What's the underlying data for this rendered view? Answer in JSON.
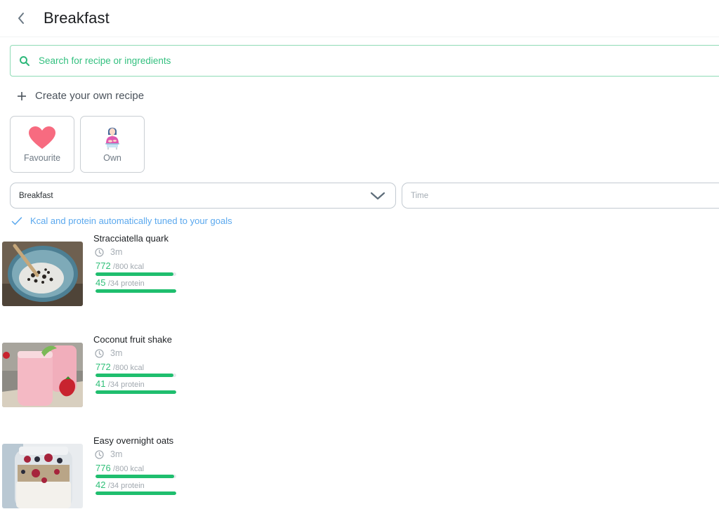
{
  "header": {
    "title": "Breakfast",
    "back_icon": "chevron-left-icon"
  },
  "search": {
    "placeholder": "Search for recipe or ingredients",
    "value": "",
    "icon": "search-icon"
  },
  "create_recipe": {
    "label": "Create your own recipe",
    "icon": "plus-icon"
  },
  "categories": [
    {
      "label": "Favourite",
      "icon": "heart-icon"
    },
    {
      "label": "Own",
      "icon": "chef-woman-icon"
    }
  ],
  "filters": {
    "meal_select": {
      "value": "Breakfast",
      "icon": "chevron-down-icon"
    },
    "time_input": {
      "placeholder": "Time",
      "value": ""
    }
  },
  "notice": {
    "label": "Kcal and protein automatically tuned to your goals",
    "icon": "check-icon"
  },
  "recipes": [
    {
      "name": "Stracciatella quark",
      "time": "3m",
      "kcal": {
        "value": "772",
        "goal": "/800 kcal",
        "progress": 0.965
      },
      "protein": {
        "value": "45",
        "goal": "/34 protein",
        "progress": 1.0
      },
      "image": "stracciatella-quark-photo"
    },
    {
      "name": "Coconut fruit shake",
      "time": "3m",
      "kcal": {
        "value": "772",
        "goal": "/800 kcal",
        "progress": 0.965
      },
      "protein": {
        "value": "41",
        "goal": "/34 protein",
        "progress": 1.0
      },
      "image": "coconut-fruit-shake-photo"
    },
    {
      "name": "Easy overnight oats",
      "time": "3m",
      "kcal": {
        "value": "776",
        "goal": "/800 kcal",
        "progress": 0.97
      },
      "protein": {
        "value": "42",
        "goal": "/34 protein",
        "progress": 1.0
      },
      "image": "easy-overnight-oats-photo"
    }
  ],
  "colors": {
    "accent_green": "#2fbf78",
    "bar_green": "#1fbe6e",
    "search_border": "#8fdbb5",
    "notice_blue": "#5aa8ee",
    "heart_pink": "#f76b80"
  }
}
